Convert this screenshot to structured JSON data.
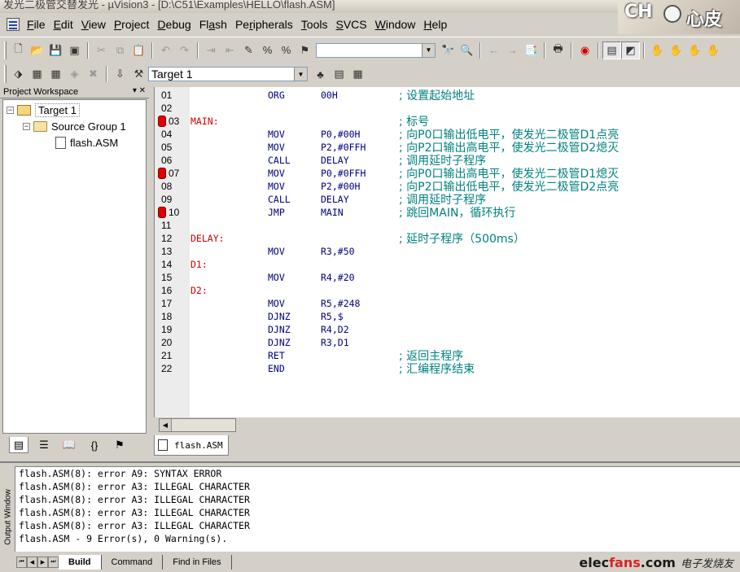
{
  "window": {
    "title": "发光二极管交替发光 - µVision3 - [D:\\C51\\Examples\\HELLO\\flash.ASM]"
  },
  "logo": {
    "text_left": "CH",
    "text_right": "心皮"
  },
  "menu": [
    "File",
    "Edit",
    "View",
    "Project",
    "Debug",
    "Flash",
    "Peripherals",
    "Tools",
    "SVCS",
    "Window",
    "Help"
  ],
  "menu_mnemonics": [
    "F",
    "E",
    "V",
    "P",
    "D",
    "a",
    "r",
    "T",
    "S",
    "W",
    "H"
  ],
  "toolbar": {
    "find_combo_value": "",
    "target_combo_value": "Target 1"
  },
  "workspace": {
    "title": "Project Workspace",
    "tree": {
      "target": "Target 1",
      "group": "Source Group 1",
      "file": "flash.ASM"
    }
  },
  "editor": {
    "file_tab": "flash.ASM",
    "lines": [
      {
        "n": "01",
        "label": "",
        "op": "ORG",
        "arg": "00H",
        "comment": "; 设置起始地址",
        "bp": false
      },
      {
        "n": "02",
        "label": "",
        "op": "",
        "arg": "",
        "comment": "",
        "bp": false
      },
      {
        "n": "03",
        "label": "MAIN:",
        "op": "",
        "arg": "",
        "comment": "; 标号",
        "bp": true
      },
      {
        "n": "04",
        "label": "",
        "op": "MOV",
        "arg": "P0,#00H",
        "comment": "; 向P0口输出低电平，使发光二极管D1点亮",
        "bp": false
      },
      {
        "n": "05",
        "label": "",
        "op": "MOV",
        "arg": "P2,#0FFH",
        "comment": "; 向P2口输出高电平，使发光二极管D2熄灭",
        "bp": false
      },
      {
        "n": "06",
        "label": "",
        "op": "CALL",
        "arg": "DELAY",
        "comment": "; 调用延时子程序",
        "bp": false
      },
      {
        "n": "07",
        "label": "",
        "op": "MOV",
        "arg": "P0,#0FFH",
        "comment": "; 向P0口输出高电平，使发光二极管D1熄灭",
        "bp": true
      },
      {
        "n": "08",
        "label": "",
        "op": "MOV",
        "arg": "P2,#00H",
        "comment": "; 向P2口输出低电平，使发光二极管D2点亮",
        "bp": false
      },
      {
        "n": "09",
        "label": "",
        "op": "CALL",
        "arg": "DELAY",
        "comment": "; 调用延时子程序",
        "bp": false
      },
      {
        "n": "10",
        "label": "",
        "op": "JMP",
        "arg": "MAIN",
        "comment": "; 跳回MAIN，循环执行",
        "bp": true
      },
      {
        "n": "11",
        "label": "",
        "op": "",
        "arg": "",
        "comment": "",
        "bp": false
      },
      {
        "n": "12",
        "label": "DELAY:",
        "op": "",
        "arg": "",
        "comment": "; 延时子程序（500ms）",
        "bp": false
      },
      {
        "n": "13",
        "label": "",
        "op": "MOV",
        "arg": "R3,#50",
        "comment": "",
        "bp": false
      },
      {
        "n": "14",
        "label": "D1:",
        "op": "",
        "arg": "",
        "comment": "",
        "bp": false
      },
      {
        "n": "15",
        "label": "",
        "op": "MOV",
        "arg": "R4,#20",
        "comment": "",
        "bp": false
      },
      {
        "n": "16",
        "label": "D2:",
        "op": "",
        "arg": "",
        "comment": "",
        "bp": false
      },
      {
        "n": "17",
        "label": "",
        "op": "MOV",
        "arg": "R5,#248",
        "comment": "",
        "bp": false
      },
      {
        "n": "18",
        "label": "",
        "op": "DJNZ",
        "arg": "R5,$",
        "comment": "",
        "bp": false
      },
      {
        "n": "19",
        "label": "",
        "op": "DJNZ",
        "arg": "R4,D2",
        "comment": "",
        "bp": false
      },
      {
        "n": "20",
        "label": "",
        "op": "DJNZ",
        "arg": "R3,D1",
        "comment": "",
        "bp": false
      },
      {
        "n": "21",
        "label": "",
        "op": "RET",
        "arg": "",
        "comment": "; 返回主程序",
        "bp": false
      },
      {
        "n": "22",
        "label": "",
        "op": "END",
        "arg": "",
        "comment": "; 汇编程序结束",
        "bp": false
      }
    ]
  },
  "output": {
    "side_title": "Output Window",
    "lines": [
      "flash.ASM(8): error A9: SYNTAX ERROR",
      "flash.ASM(8): error A3: ILLEGAL CHARACTER",
      "flash.ASM(8): error A3: ILLEGAL CHARACTER",
      "flash.ASM(8): error A3: ILLEGAL CHARACTER",
      "flash.ASM(8): error A3: ILLEGAL CHARACTER",
      "flash.ASM - 9 Error(s), 0 Warning(s)."
    ],
    "tabs": [
      "Build",
      "Command",
      "Find in Files"
    ]
  },
  "brand": {
    "domain_part1": "elec",
    "domain_part2": "fans",
    "domain_part3": ".com",
    "cn": "电子发烧友"
  },
  "colors": {
    "label": "#cc0000",
    "code": "#000080",
    "comment": "#008080",
    "breakpoint": "#e00000"
  }
}
